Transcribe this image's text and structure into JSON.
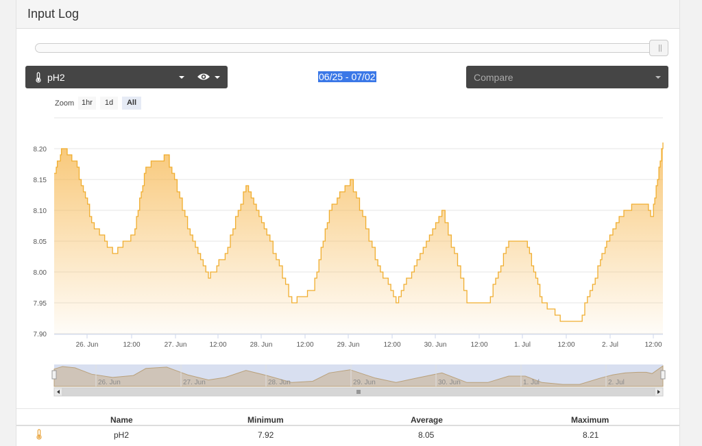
{
  "header": {
    "title": "Input Log"
  },
  "controls": {
    "input_select": {
      "icon": "thermometer-icon",
      "label": "pH2"
    },
    "visibility": {
      "icon": "eye-icon"
    },
    "date_range": "06/25 - 07/02",
    "compare": {
      "placeholder": "Compare"
    },
    "zoom": {
      "label": "Zoom",
      "buttons": [
        "1hr",
        "1d",
        "All"
      ],
      "active": "All"
    }
  },
  "chart_data": {
    "type": "area",
    "series": [
      {
        "name": "pH2",
        "color": "#f0ad2e"
      }
    ],
    "x_range": [
      "2025-06-25 09:00",
      "2025-07-02 13:00"
    ],
    "x_ticks": [
      "26. Jun",
      "12:00",
      "27. Jun",
      "12:00",
      "28. Jun",
      "12:00",
      "29. Jun",
      "12:00",
      "30. Jun",
      "12:00",
      "1. Jul",
      "12:00",
      "2. Jul",
      "12:00"
    ],
    "y_ticks": [
      "8.20",
      "8.15",
      "8.10",
      "8.05",
      "8.00",
      "7.95",
      "7.90"
    ],
    "ylim": [
      7.9,
      8.2
    ],
    "grid": true,
    "points_x_days": [
      0,
      0.1,
      0.25,
      0.45,
      0.7,
      0.95,
      1.1,
      1.35,
      1.6,
      1.85,
      2.05,
      2.3,
      2.55,
      2.85,
      3.1,
      3.3,
      3.55,
      3.85,
      4.1,
      4.35,
      4.65,
      4.95,
      5.2,
      5.45,
      5.65,
      5.85,
      6.1,
      6.3,
      6.55,
      6.7,
      6.85,
      7.0,
      7.1,
      7.3,
      7.17
    ],
    "points_y": [
      8.16,
      8.2,
      8.18,
      8.08,
      8.03,
      8.06,
      8.17,
      8.19,
      8.07,
      7.99,
      8.03,
      8.14,
      8.06,
      7.95,
      7.97,
      8.1,
      8.15,
      8.02,
      7.95,
      8.02,
      8.1,
      7.95,
      7.95,
      8.05,
      8.05,
      7.95,
      7.92,
      7.92,
      8.02,
      8.07,
      8.1,
      8.11,
      8.11,
      8.21,
      8.09
    ],
    "navigator_labels": [
      "26. Jun",
      "27. Jun",
      "28. Jun",
      "29. Jun",
      "30. Jun",
      "1. Jul",
      "2. Jul"
    ]
  },
  "table": {
    "columns": [
      "Name",
      "Minimum",
      "Average",
      "Maximum"
    ],
    "rows": [
      {
        "icon": "thermometer-icon",
        "name": "pH2",
        "min": "7.92",
        "avg": "8.05",
        "max": "8.21"
      }
    ]
  }
}
